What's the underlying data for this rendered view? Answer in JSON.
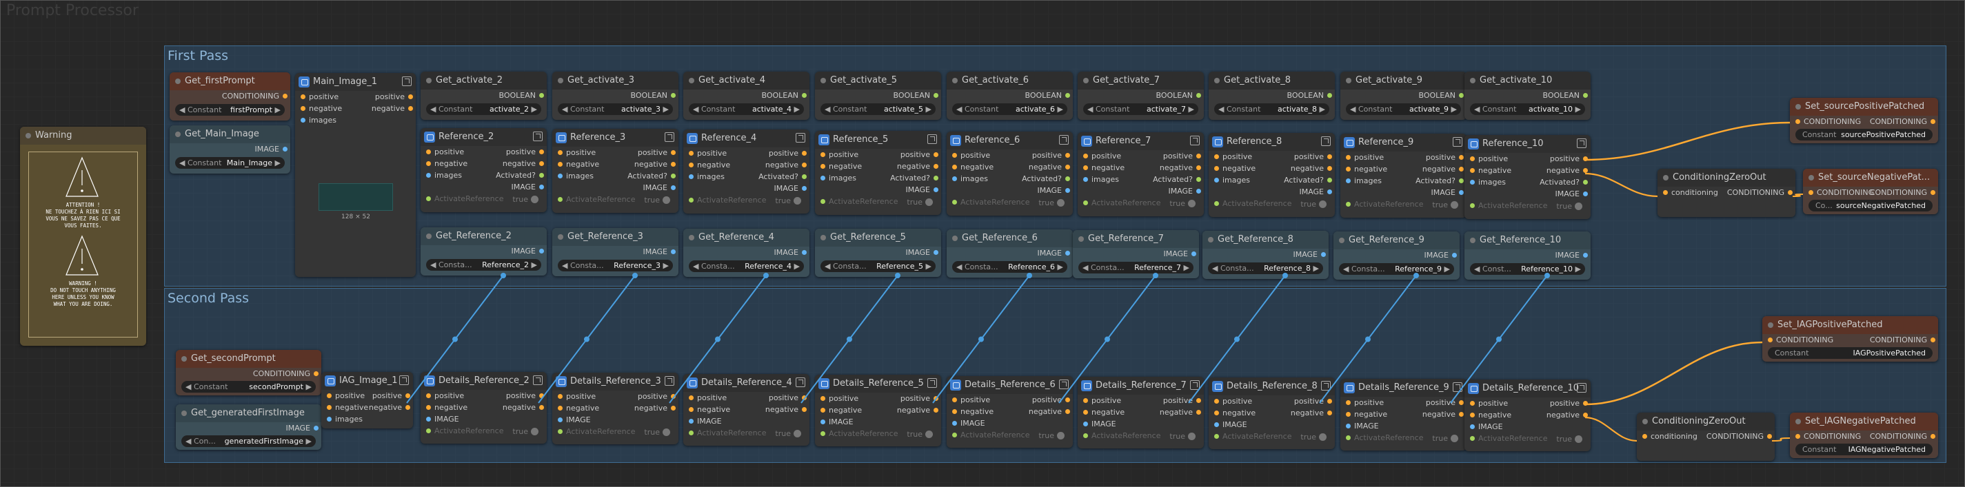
{
  "group": {
    "title": "Prompt Processor"
  },
  "sections": {
    "first": "First Pass",
    "second": "Second Pass"
  },
  "warning": {
    "title": "Warning",
    "fr_lines": [
      "ATTENTION !",
      "NE TOUCHEZ À RIEN ICI SI",
      "VOUS NE SAVEZ PAS CE QUE",
      "VOUS FAITES."
    ],
    "en_lines": [
      "WARNING !",
      "DO NOT TOUCH ANYTHING",
      "HERE UNLESS YOU KNOW",
      "WHAT YOU ARE DOING."
    ]
  },
  "labels": {
    "conditioning_caps": "CONDITIONING",
    "conditioning": "conditioning",
    "image_caps": "IMAGE",
    "boolean": "BOOLEAN",
    "constant": "Constant",
    "constant_short": "Consta...",
    "const_shorter": "Const...",
    "const_co": "Co...",
    "con_short": "Con...",
    "positive": "positive",
    "negative": "negative",
    "images": "images",
    "image": "IMAGE",
    "activated": "Activated?",
    "activate_ref": "ActivateReference",
    "true": "true"
  },
  "nodes": {
    "get_first_prompt": {
      "title": "Get_firstPrompt",
      "value": "firstPrompt"
    },
    "get_main_image": {
      "title": "Get_Main_Image",
      "value": "Main_Image"
    },
    "main_image_1": {
      "title": "Main_Image_1",
      "size": "128 × 52"
    },
    "get_second_prompt": {
      "title": "Get_secondPrompt",
      "value": "secondPrompt"
    },
    "get_generated_first_image": {
      "title": "Get_generatedFirstImage",
      "value": "generatedFirstImage"
    },
    "iag_image_1": {
      "title": "IAG_Image_1"
    },
    "set_source_positive": {
      "title": "Set_sourcePositivePatched",
      "value": "sourcePositivePatched"
    },
    "set_source_negative": {
      "title": "Set_sourceNegativePat...",
      "value": "sourceNegativePatched"
    },
    "set_iag_positive": {
      "title": "Set_IAGPositivePatched",
      "value": "IAGPositivePatched"
    },
    "set_iag_negative": {
      "title": "Set_IAGNegativePatched",
      "value": "IAGNegativePatched"
    },
    "cond_zero_out_1": {
      "title": "ConditioningZeroOut"
    },
    "cond_zero_out_2": {
      "title": "ConditioningZeroOut"
    }
  },
  "activates": [
    {
      "title": "Get_activate_2",
      "value": "activate_2"
    },
    {
      "title": "Get_activate_3",
      "value": "activate_3"
    },
    {
      "title": "Get_activate_4",
      "value": "activate_4"
    },
    {
      "title": "Get_activate_5",
      "value": "activate_5"
    },
    {
      "title": "Get_activate_6",
      "value": "activate_6"
    },
    {
      "title": "Get_activate_7",
      "value": "activate_7"
    },
    {
      "title": "Get_activate_8",
      "value": "activate_8"
    },
    {
      "title": "Get_activate_9",
      "value": "activate_9"
    },
    {
      "title": "Get_activate_10",
      "value": "activate_10"
    }
  ],
  "references": [
    "Reference_2",
    "Reference_3",
    "Reference_4",
    "Reference_5",
    "Reference_6",
    "Reference_7",
    "Reference_8",
    "Reference_9",
    "Reference_10"
  ],
  "get_references": [
    {
      "title": "Get_Reference_2",
      "value": "Reference_2"
    },
    {
      "title": "Get_Reference_3",
      "value": "Reference_3"
    },
    {
      "title": "Get_Reference_4",
      "value": "Reference_4"
    },
    {
      "title": "Get_Reference_5",
      "value": "Reference_5"
    },
    {
      "title": "Get_Reference_6",
      "value": "Reference_6"
    },
    {
      "title": "Get_Reference_7",
      "value": "Reference_7"
    },
    {
      "title": "Get_Reference_8",
      "value": "Reference_8"
    },
    {
      "title": "Get_Reference_9",
      "value": "Reference_9"
    },
    {
      "title": "Get_Reference_10",
      "value": "Reference_10"
    }
  ],
  "details": [
    "Details_Reference_2",
    "Details_Reference_3",
    "Details_Reference_4",
    "Details_Reference_5",
    "Details_Reference_6",
    "Details_Reference_7",
    "Details_Reference_8",
    "Details_Reference_9",
    "Details_Reference_10"
  ],
  "colors": {
    "conditioning": "#ffa931",
    "image": "#64b5f6",
    "boolean": "#a5d65c",
    "wire_image": "#4a9fe0",
    "wire_cond": "#ffa931"
  }
}
